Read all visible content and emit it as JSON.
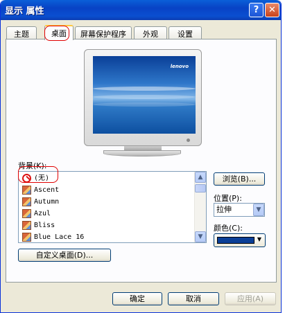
{
  "window": {
    "title": "显示 属性"
  },
  "title_buttons": {
    "help": "?",
    "close": "✕"
  },
  "tabs": [
    "主题",
    "桌面",
    "屏幕保护程序",
    "外观",
    "设置"
  ],
  "active_tab": "桌面",
  "preview": {
    "brand": "lenovo"
  },
  "background": {
    "label": "背景(K):",
    "items": [
      {
        "label": "(无)",
        "icon": "no-icon"
      },
      {
        "label": "Ascent",
        "icon": "image-icon"
      },
      {
        "label": "Autumn",
        "icon": "image-icon"
      },
      {
        "label": "Azul",
        "icon": "image-icon"
      },
      {
        "label": "Bliss",
        "icon": "image-icon"
      },
      {
        "label": "Blue Lace 16",
        "icon": "image-icon"
      }
    ],
    "browse_label": "浏览(B)..."
  },
  "position": {
    "label": "位置(P):",
    "value": "拉伸"
  },
  "color": {
    "label": "颜色(C):",
    "value": "#0a3f97"
  },
  "customize_label": "自定义桌面(D)...",
  "footer": {
    "ok_label": "确定",
    "cancel_label": "取消",
    "apply_label": "应用(A)"
  }
}
